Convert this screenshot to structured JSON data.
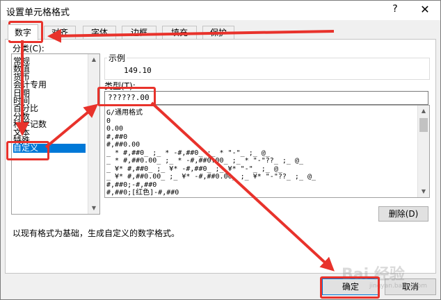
{
  "dialog": {
    "title": "设置单元格格式",
    "help": "?",
    "close": "✕"
  },
  "tabs": [
    "数字",
    "对齐",
    "字体",
    "边框",
    "填充",
    "保护"
  ],
  "category": {
    "label": "分类(C):",
    "items": [
      "常规",
      "数值",
      "货币",
      "会计专用",
      "日期",
      "时间",
      "百分比",
      "分数",
      "科学记数",
      "文本",
      "特殊",
      "自定义"
    ],
    "selected_index": 11
  },
  "sample": {
    "label": "示例",
    "value": "149.10"
  },
  "type": {
    "label": "类型(T):",
    "value": "??????.00",
    "formats": [
      "G/通用格式",
      "0",
      "0.00",
      "#,##0",
      "#,##0.00",
      "_ * #,##0_ ;_ * -#,##0_ ;_ * \"-\"_ ;_ @_",
      "_ * #,##0.00_ ;_ * -#,##0.00_ ;_ * \"-\"??_ ;_ @_",
      "_ ¥* #,##0_ ;_ ¥* -#,##0_ ;_ ¥* \"-\"_ ;_ @_",
      "_ ¥* #,##0.00_ ;_ ¥* -#,##0.00_ ;_ ¥* \"-\"??_ ;_ @_",
      "#,##0;-#,##0",
      "#,##0;[红色]-#,##0"
    ]
  },
  "delete_button": "删除(D)",
  "description": "以现有格式为基础，生成自定义的数字格式。",
  "ok_button": "确定",
  "cancel_button": "取消",
  "watermark": {
    "text": "Bai 经验",
    "sub": "jingyan.baidu.com"
  },
  "colors": {
    "annotation_red": "#e8322b",
    "selection_blue": "#0078d7"
  }
}
